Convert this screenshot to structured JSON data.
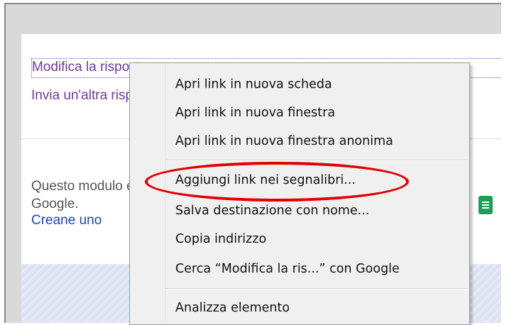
{
  "page": {
    "edit_link": "Modifica la risposta",
    "another_link": "Invia un'altra risposta",
    "google_text_line1": "Questo modulo è stato creato con Moduli",
    "google_text_line2": "Google.",
    "create_link": "Creane uno"
  },
  "context_menu": {
    "items": [
      {
        "label": "Apri link in nuova scheda"
      },
      {
        "label": "Apri link in nuova finestra"
      },
      {
        "label": "Apri link in nuova finestra anonima"
      },
      {
        "label": "Aggiungi link nei segnalibri..."
      },
      {
        "label": "Salva destinazione con nome..."
      },
      {
        "label": "Copia indirizzo"
      },
      {
        "label": "Cerca “Modifica la ris...” con Google"
      },
      {
        "label": "Analizza elemento"
      }
    ]
  },
  "icons": {
    "sheets": "google-sheets-icon"
  },
  "colors": {
    "highlight": "#e00000",
    "visited_link": "#6e3a9e",
    "link": "#1a3fd6"
  }
}
